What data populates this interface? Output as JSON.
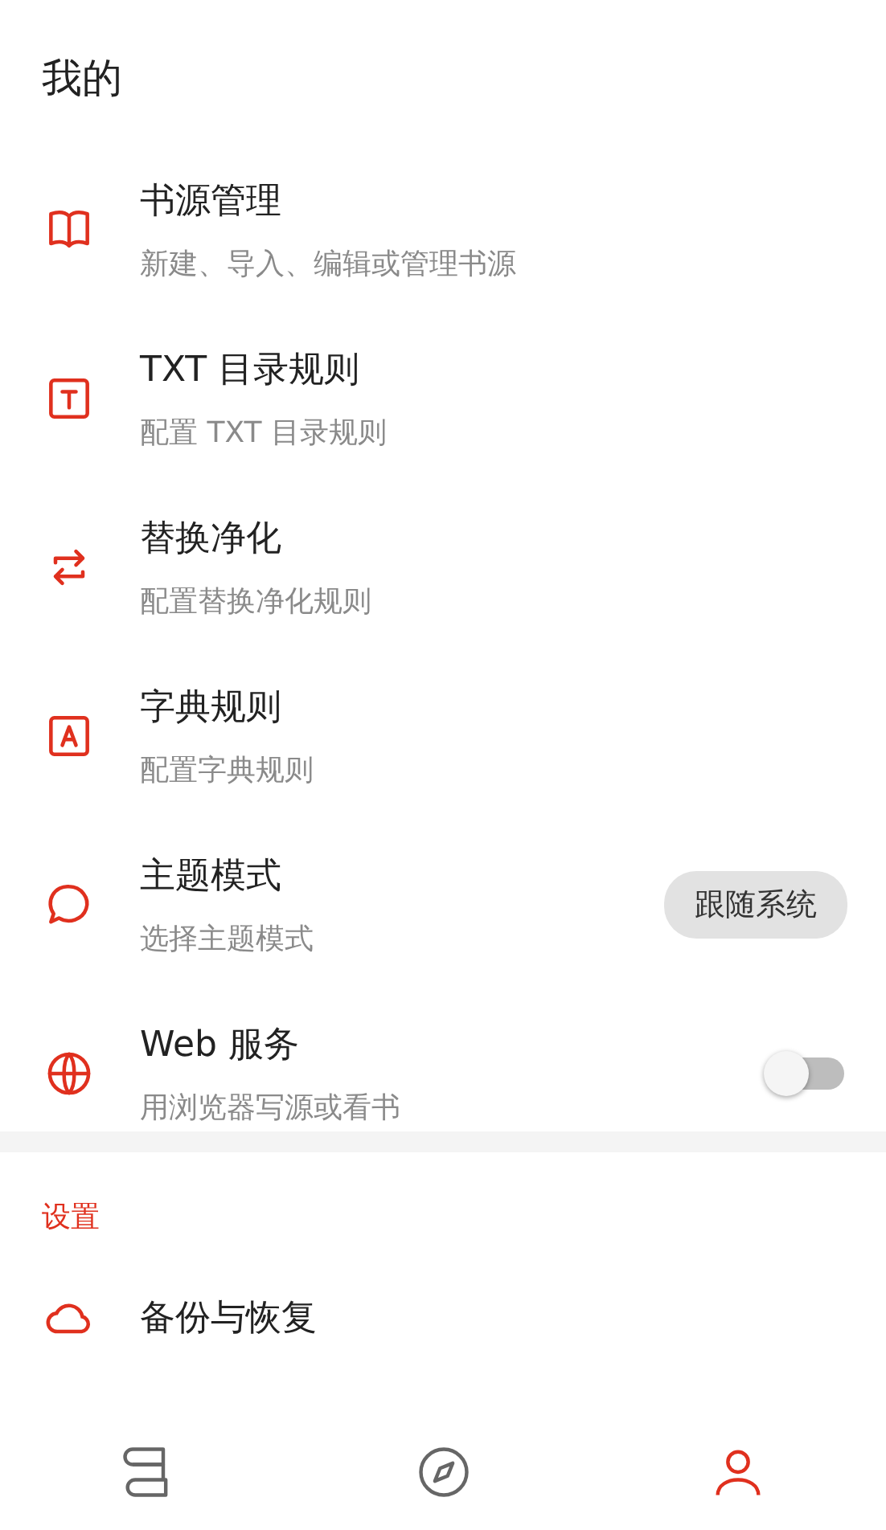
{
  "title": "我的",
  "items": [
    {
      "title": "书源管理",
      "subtitle": "新建、导入、编辑或管理书源"
    },
    {
      "title": "TXT 目录规则",
      "subtitle": "配置 TXT 目录规则"
    },
    {
      "title": "替换净化",
      "subtitle": "配置替换净化规则"
    },
    {
      "title": "字典规则",
      "subtitle": "配置字典规则"
    },
    {
      "title": "主题模式",
      "subtitle": "选择主题模式",
      "kind": "chip",
      "chip": "跟随系统"
    },
    {
      "title": "Web 服务",
      "subtitle": "用浏览器写源或看书",
      "kind": "switch",
      "on": false
    }
  ],
  "section": "设置",
  "settings": [
    {
      "title": "备份与恢复"
    }
  ],
  "nav": [
    {
      "selected": false
    },
    {
      "selected": false
    },
    {
      "selected": true
    }
  ]
}
